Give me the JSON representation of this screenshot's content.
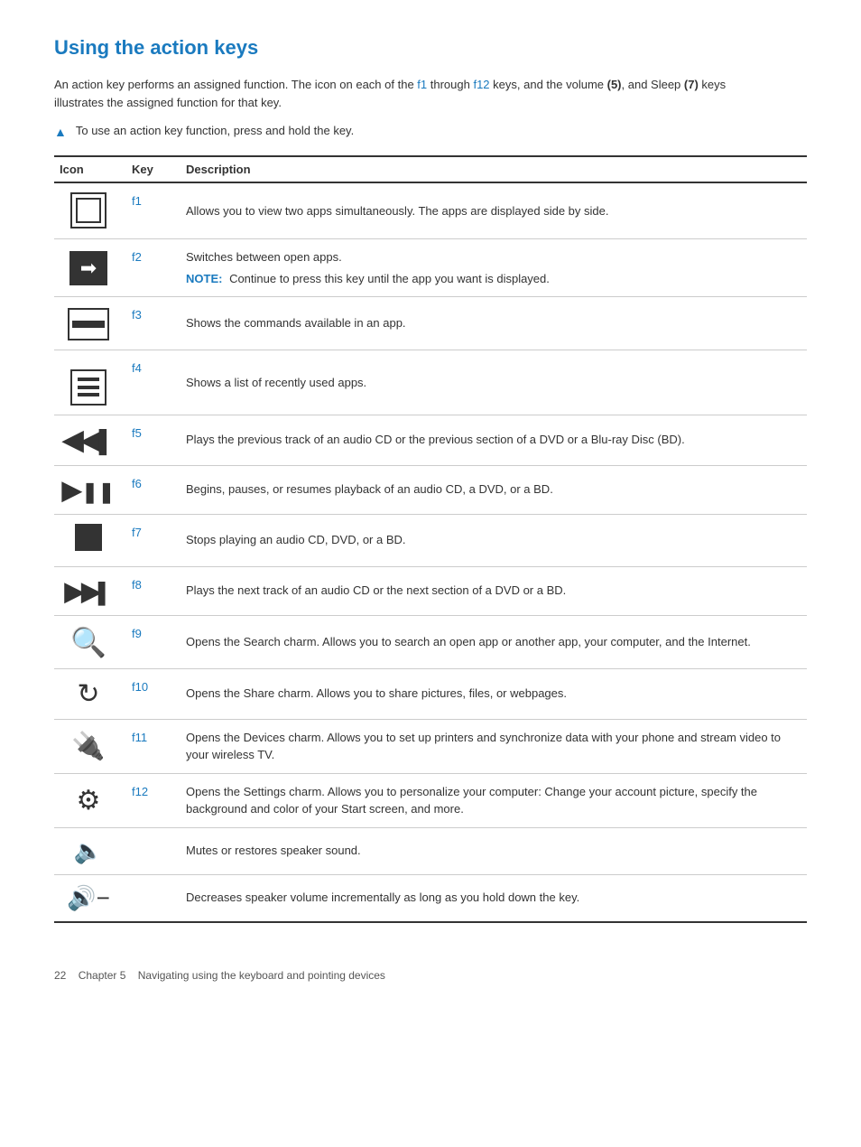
{
  "title": "Using the action keys",
  "intro": {
    "text_before_f1": "An action key performs an assigned function. The icon on each of the ",
    "f1_link": "f1",
    "text_between": " through ",
    "f12_link": "f12",
    "text_after": " keys, and the volume ",
    "bold_5": "(5)",
    "text_mid": ", and Sleep ",
    "bold_7": "(7)",
    "text_end": " keys illustrates the assigned function for that key."
  },
  "bullet": {
    "text": "To use an action key function, press and hold the key."
  },
  "table": {
    "headers": {
      "icon": "Icon",
      "key": "Key",
      "description": "Description"
    },
    "rows": [
      {
        "key": "f1",
        "key_link": true,
        "icon_type": "f1",
        "description": "Allows you to view two apps simultaneously. The apps are displayed side by side."
      },
      {
        "key": "f2",
        "key_link": true,
        "icon_type": "f2",
        "description": "Switches between open apps.",
        "note": "Continue to press this key until the app you want is displayed."
      },
      {
        "key": "f3",
        "key_link": true,
        "icon_type": "f3",
        "description": "Shows the commands available in an app."
      },
      {
        "key": "f4",
        "key_link": true,
        "icon_type": "f4",
        "description": "Shows a list of recently used apps."
      },
      {
        "key": "f5",
        "key_link": true,
        "icon_type": "f5",
        "description": "Plays the previous track of an audio CD or the previous section of a DVD or a Blu-ray Disc (BD)."
      },
      {
        "key": "f6",
        "key_link": true,
        "icon_type": "f6",
        "description": "Begins, pauses, or resumes playback of an audio CD, a DVD, or a BD."
      },
      {
        "key": "f7",
        "key_link": true,
        "icon_type": "f7",
        "description": "Stops playing an audio CD, DVD, or a BD."
      },
      {
        "key": "f8",
        "key_link": true,
        "icon_type": "f8",
        "description": "Plays the next track of an audio CD or the next section of a DVD or a BD."
      },
      {
        "key": "f9",
        "key_link": true,
        "icon_type": "search",
        "description": "Opens the Search charm. Allows you to search an open app or another app, your computer, and the Internet."
      },
      {
        "key": "f10",
        "key_link": true,
        "icon_type": "share",
        "description": "Opens the Share charm. Allows you to share pictures, files, or webpages."
      },
      {
        "key": "f11",
        "key_link": true,
        "icon_type": "devices",
        "description": "Opens the Devices charm. Allows you to set up printers and synchronize data with your phone and stream video to your wireless TV."
      },
      {
        "key": "f12",
        "key_link": true,
        "icon_type": "settings",
        "description": "Opens the Settings charm. Allows you to personalize your computer: Change your account picture, specify the background and color of your Start screen, and more."
      },
      {
        "key": "",
        "key_link": false,
        "icon_type": "mute",
        "description": "Mutes or restores speaker sound."
      },
      {
        "key": "",
        "key_link": false,
        "icon_type": "voldown",
        "description": "Decreases speaker volume incrementally as long as you hold down the key."
      }
    ],
    "note_label": "NOTE:"
  },
  "footer": {
    "page": "22",
    "chapter": "Chapter 5",
    "chapter_text": "Navigating using the keyboard and pointing devices"
  }
}
